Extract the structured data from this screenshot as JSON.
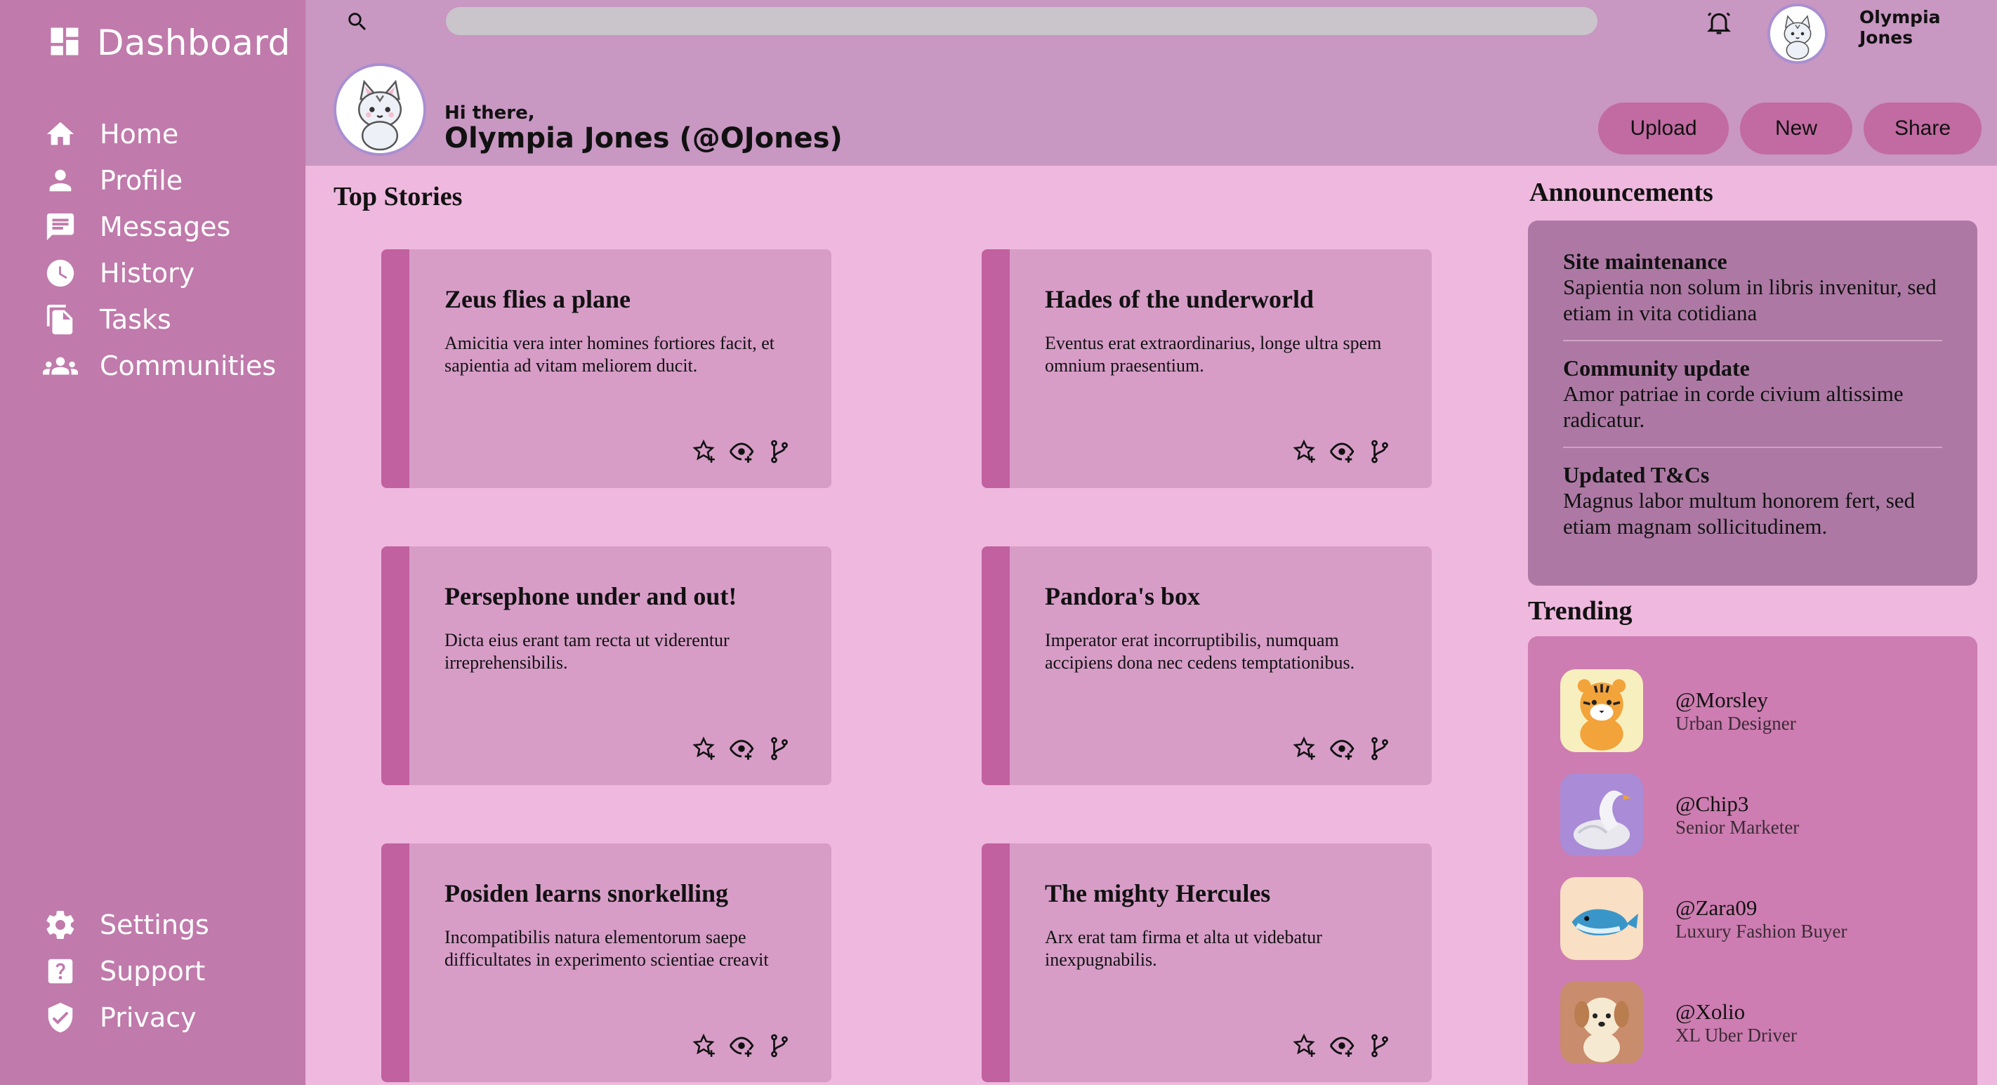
{
  "sidebar": {
    "brand": "Dashboard",
    "items": [
      {
        "label": "Home",
        "icon": "home-icon"
      },
      {
        "label": "Profile",
        "icon": "person-icon"
      },
      {
        "label": "Messages",
        "icon": "message-icon"
      },
      {
        "label": "History",
        "icon": "clock-icon"
      },
      {
        "label": "Tasks",
        "icon": "documents-icon"
      },
      {
        "label": "Communities",
        "icon": "group-icon"
      }
    ],
    "bottom": [
      {
        "label": "Settings",
        "icon": "gear-icon"
      },
      {
        "label": "Support",
        "icon": "help-icon"
      },
      {
        "label": "Privacy",
        "icon": "shield-icon"
      }
    ]
  },
  "header": {
    "user_name": "Olympia Jones",
    "greeting": "Hi there,",
    "full_name": "Olympia Jones (@OJones)",
    "buttons": {
      "upload": "Upload",
      "new": "New",
      "share": "Share"
    }
  },
  "main": {
    "title": "Top Stories",
    "stories": [
      {
        "title": "Zeus flies a plane",
        "body": "Amicitia vera inter homines fortiores facit, et sapientia ad vitam meliorem ducit."
      },
      {
        "title": "Hades of the underworld",
        "body": "Eventus erat extraordinarius, longe ultra spem omnium praesentium."
      },
      {
        "title": "Persephone under and out!",
        "body": "Dicta eius erant tam recta ut viderentur irreprehensibilis."
      },
      {
        "title": "Pandora's box",
        "body": "Imperator erat incorruptibilis, numquam accipiens dona nec cedens temptationibus."
      },
      {
        "title": "Posiden learns snorkelling",
        "body": "Incompatibilis natura elementorum saepe difficultates in experimento scientiae creavit"
      },
      {
        "title": "The mighty Hercules",
        "body": "Arx erat tam firma et alta ut videbatur inexpugnabilis."
      }
    ]
  },
  "announcements": {
    "title": "Announcements",
    "items": [
      {
        "heading": "Site maintenance",
        "body": "Sapientia non solum in libris invenitur, sed etiam in vita cotidiana"
      },
      {
        "heading": "Community update",
        "body": "Amor patriae in corde civium altissime radicatur."
      },
      {
        "heading": "Updated T&Cs",
        "body": "Magnus labor multum honorem fert, sed etiam magnam sollicitudinem."
      }
    ]
  },
  "trending": {
    "title": "Trending",
    "items": [
      {
        "handle": "@Morsley",
        "role": "Urban Designer",
        "avatar": "tiger-avatar"
      },
      {
        "handle": "@Chip3",
        "role": "Senior Marketer",
        "avatar": "swan-avatar"
      },
      {
        "handle": "@Zara09",
        "role": "Luxury Fashion Buyer",
        "avatar": "whale-avatar"
      },
      {
        "handle": "@Xolio",
        "role": "XL Uber Driver",
        "avatar": "dog-avatar"
      }
    ]
  },
  "colors": {
    "sidebar": "#c07aab",
    "header": "#c897c2",
    "page": "#efb8de",
    "card": "#d79dc7",
    "accent": "#c2619f"
  }
}
